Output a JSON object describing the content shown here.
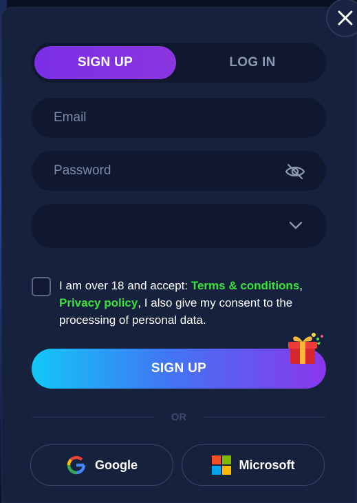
{
  "tabs": {
    "signup": "SIGN UP",
    "login": "LOG IN"
  },
  "form": {
    "email_placeholder": "Email",
    "password_placeholder": "Password"
  },
  "consent": {
    "prefix": "I am over 18 and accept: ",
    "terms": "Terms & conditions",
    "comma": ",",
    "privacy": "Privacy policy",
    "suffix": ", I also give my consent to the processing of personal data."
  },
  "signup_button": "SIGN UP",
  "divider": "OR",
  "social": {
    "google": "Google",
    "microsoft": "Microsoft"
  },
  "colors": {
    "accent_purple": "#7b2fe6",
    "link_green": "#39e23b",
    "background": "#16213d"
  },
  "icons": [
    "close-icon",
    "eye-off-icon",
    "chevron-down-icon",
    "gift-icon",
    "google-icon",
    "microsoft-icon"
  ]
}
